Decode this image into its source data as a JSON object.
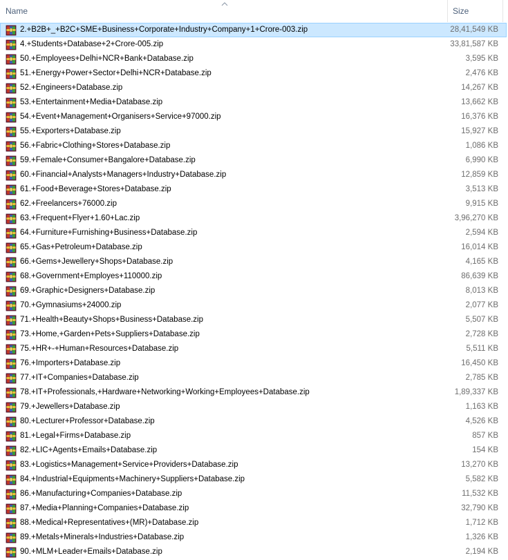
{
  "columns": {
    "name": "Name",
    "size": "Size"
  },
  "selected_index": 0,
  "files": [
    {
      "name": "2.+B2B+_+B2C+SME+Business+Corporate+Industry+Company+1+Crore-003.zip",
      "size": "28,41,549 KB"
    },
    {
      "name": "4.+Students+Database+2+Crore-005.zip",
      "size": "33,81,587 KB"
    },
    {
      "name": "50.+Employees+Delhi+NCR+Bank+Database.zip",
      "size": "3,595 KB"
    },
    {
      "name": "51.+Energy+Power+Sector+Delhi+NCR+Database.zip",
      "size": "2,476 KB"
    },
    {
      "name": "52.+Engineers+Database.zip",
      "size": "14,267 KB"
    },
    {
      "name": "53.+Entertainment+Media+Database.zip",
      "size": "13,662 KB"
    },
    {
      "name": "54.+Event+Management+Organisers+Service+97000.zip",
      "size": "16,376 KB"
    },
    {
      "name": "55.+Exporters+Database.zip",
      "size": "15,927 KB"
    },
    {
      "name": "56.+Fabric+Clothing+Stores+Database.zip",
      "size": "1,086 KB"
    },
    {
      "name": "59.+Female+Consumer+Bangalore+Database.zip",
      "size": "6,990 KB"
    },
    {
      "name": "60.+Financial+Analysts+Managers+Industry+Database.zip",
      "size": "12,859 KB"
    },
    {
      "name": "61.+Food+Beverage+Stores+Database.zip",
      "size": "3,513 KB"
    },
    {
      "name": "62.+Freelancers+76000.zip",
      "size": "9,915 KB"
    },
    {
      "name": "63.+Frequent+Flyer+1.60+Lac.zip",
      "size": "3,96,270 KB"
    },
    {
      "name": "64.+Furniture+Furnishing+Business+Database.zip",
      "size": "2,594 KB"
    },
    {
      "name": "65.+Gas+Petroleum+Database.zip",
      "size": "16,014 KB"
    },
    {
      "name": "66.+Gems+Jewellery+Shops+Database.zip",
      "size": "4,165 KB"
    },
    {
      "name": "68.+Government+Employes+110000.zip",
      "size": "86,639 KB"
    },
    {
      "name": "69.+Graphic+Designers+Database.zip",
      "size": "8,013 KB"
    },
    {
      "name": "70.+Gymnasiums+24000.zip",
      "size": "2,077 KB"
    },
    {
      "name": "71.+Health+Beauty+Shops+Business+Database.zip",
      "size": "5,507 KB"
    },
    {
      "name": "73.+Home,+Garden+Pets+Suppliers+Database.zip",
      "size": "2,728 KB"
    },
    {
      "name": "75.+HR+-+Human+Resources+Database.zip",
      "size": "5,511 KB"
    },
    {
      "name": "76.+Importers+Database.zip",
      "size": "16,450 KB"
    },
    {
      "name": "77.+IT+Companies+Database.zip",
      "size": "2,785 KB"
    },
    {
      "name": "78.+IT+Professionals,+Hardware+Networking+Working+Employees+Database.zip",
      "size": "1,89,337 KB"
    },
    {
      "name": "79.+Jewellers+Database.zip",
      "size": "1,163 KB"
    },
    {
      "name": "80.+Lecturer+Professor+Database.zip",
      "size": "4,526 KB"
    },
    {
      "name": "81.+Legal+Firms+Database.zip",
      "size": "857 KB"
    },
    {
      "name": "82.+LIC+Agents+Emails+Database.zip",
      "size": "154 KB"
    },
    {
      "name": "83.+Logistics+Management+Service+Providers+Database.zip",
      "size": "13,270 KB"
    },
    {
      "name": "84.+Industrial+Equipments+Machinery+Suppliers+Database.zip",
      "size": "5,582 KB"
    },
    {
      "name": "86.+Manufacturing+Companies+Database.zip",
      "size": "11,532 KB"
    },
    {
      "name": "87.+Media+Planning+Companies+Database.zip",
      "size": "32,790 KB"
    },
    {
      "name": "88.+Medical+Representatives+(MR)+Database.zip",
      "size": "1,712 KB"
    },
    {
      "name": "89.+Metals+Minerals+Industries+Database.zip",
      "size": "1,326 KB"
    },
    {
      "name": "90.+MLM+Leader+Emails+Database.zip",
      "size": "2,194 KB"
    }
  ],
  "file_icon": "winrar-archive-icon",
  "colors": {
    "selected_bg": "#cce8ff",
    "selected_border": "#99d1ff",
    "header_text": "#4c607a",
    "size_text": "#6d6d6d"
  }
}
